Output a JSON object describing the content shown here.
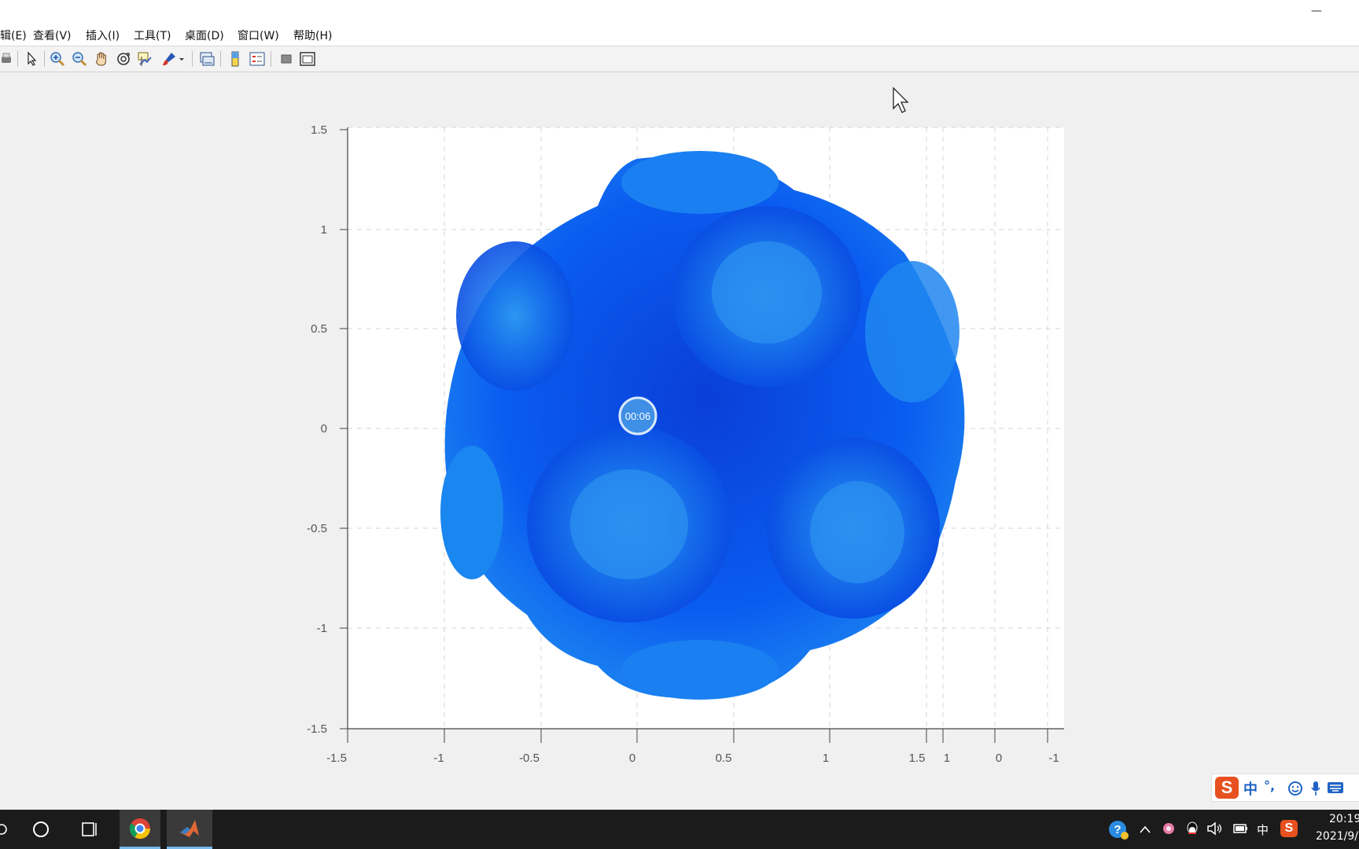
{
  "window": {
    "minimize_glyph": "—"
  },
  "menu": {
    "items": [
      "辑(E)",
      "查看(V)",
      "插入(I)",
      "工具(T)",
      "桌面(D)",
      "窗口(W)",
      "帮助(H)"
    ]
  },
  "toolbar": {
    "buttons": [
      "print-icon",
      "pointer-icon",
      "zoom-in-icon",
      "zoom-out-icon",
      "pan-hand-icon",
      "rotate-3d-icon",
      "data-cursor-icon",
      "brush-icon",
      "brush-dropdown-icon",
      "link-plot-icon",
      "colorbar-icon",
      "legend-icon",
      "hide-plot-tools-icon",
      "show-plot-tools-icon"
    ]
  },
  "plot": {
    "y_ticks": [
      "1.5",
      "1",
      "0.5",
      "0",
      "-0.5",
      "-1",
      "-1.5"
    ],
    "x_ticks": [
      "-1.5",
      "-1",
      "-0.5",
      "0",
      "0.5",
      "1",
      "1.5"
    ],
    "x_ticks_right": [
      "1",
      "0",
      "-1"
    ],
    "grid": true,
    "content": "blue 3D rose bouquet surface",
    "colors": {
      "rose_dark": "#0033d6",
      "rose_mid": "#0a5cf0",
      "rose_light": "#2f9df0"
    }
  },
  "timer_overlay": {
    "text": "00:06"
  },
  "ime": {
    "zh_label": "中",
    "punct_label": "°,"
  },
  "taskbar": {
    "apps": [
      "search-circle-icon",
      "task-view-icon",
      "chrome-icon",
      "matlab-icon"
    ],
    "tray": {
      "ime_lang": "中",
      "time": "20:19",
      "date": "2021/9/"
    }
  }
}
